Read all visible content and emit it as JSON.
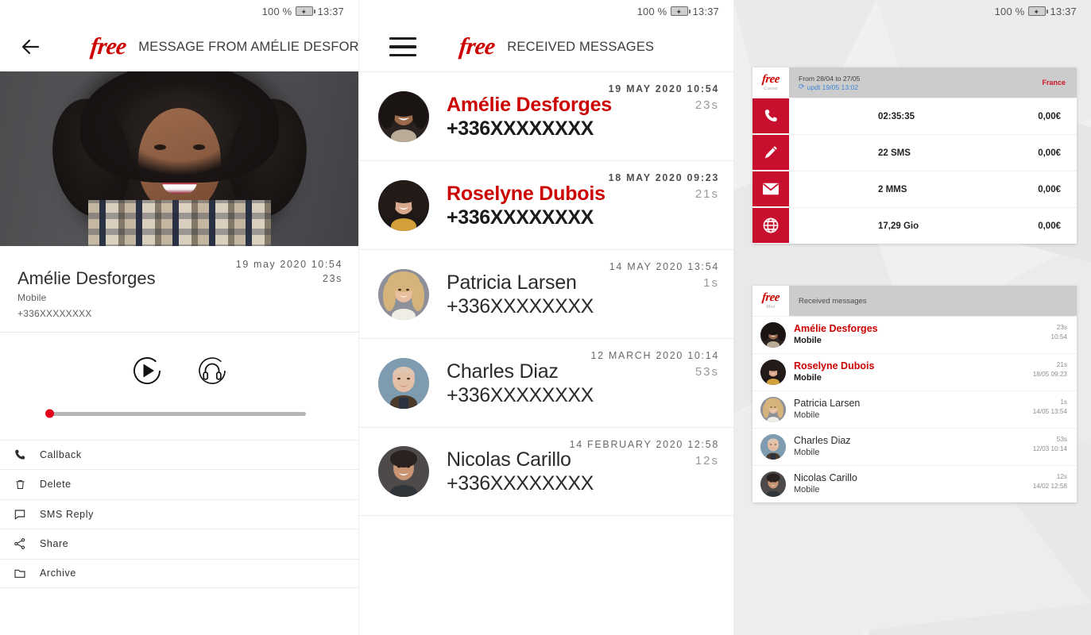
{
  "status_bar": {
    "battery": "100 %",
    "time": "13:37",
    "battery_icon": "battery-charging-icon"
  },
  "brand": {
    "logo_text": "free",
    "logo_color": "#cc0000"
  },
  "panel_detail": {
    "back_icon": "back-arrow-icon",
    "title": "MESSAGE FROM AMÉLIE DESFORGES",
    "hero_alt": "contact-portrait",
    "date": "19 may 2020 10:54",
    "duration": "23s",
    "name": "Amélie Desforges",
    "line_type": "Mobile",
    "phone": "+336XXXXXXXX",
    "player": {
      "play_icon": "play-circle-icon",
      "headphones_icon": "headphones-circle-icon",
      "progress_percent": 0
    },
    "actions": [
      {
        "label": "Callback",
        "icon": "phone-icon"
      },
      {
        "label": "Delete",
        "icon": "trash-icon"
      },
      {
        "label": "SMS Reply",
        "icon": "message-icon"
      },
      {
        "label": "Share",
        "icon": "share-icon"
      },
      {
        "label": "Archive",
        "icon": "folder-icon"
      }
    ]
  },
  "panel_list": {
    "menu_icon": "hamburger-menu-icon",
    "title": "RECEIVED MESSAGES",
    "messages": [
      {
        "name": "Amélie Desforges",
        "phone": "+336XXXXXXXX",
        "date": "19 MAY 2020 10:54",
        "duration": "23s",
        "unread": true
      },
      {
        "name": "Roselyne Dubois",
        "phone": "+336XXXXXXXX",
        "date": "18 MAY 2020 09:23",
        "duration": "21s",
        "unread": true
      },
      {
        "name": "Patricia Larsen",
        "phone": "+336XXXXXXXX",
        "date": "14 MAY 2020 13:54",
        "duration": "1s",
        "unread": false
      },
      {
        "name": "Charles Diaz",
        "phone": "+336XXXXXXXX",
        "date": "12 MARCH 2020 10:14",
        "duration": "53s",
        "unread": false
      },
      {
        "name": "Nicolas Carillo",
        "phone": "+336XXXXXXXX",
        "date": "14 FEBRUARY 2020 12:58",
        "duration": "12s",
        "unread": false
      }
    ]
  },
  "panel_tablet": {
    "consumption_widget": {
      "logo_text": "free",
      "logo_sub": "Conso",
      "period": "From 28/04 to 27/05",
      "updated": "updt 19/05 13:02",
      "refresh_icon": "refresh-icon",
      "zone": "France",
      "rows": [
        {
          "icon": "phone-icon",
          "value": "02:35:35",
          "price": "0,00€"
        },
        {
          "icon": "pencil-sms-icon",
          "value": "22 SMS",
          "price": "0,00€"
        },
        {
          "icon": "envelope-mms-icon",
          "value": "2 MMS",
          "price": "0,00€"
        },
        {
          "icon": "globe-data-icon",
          "value": "17,29 Gio",
          "price": "0,00€"
        }
      ]
    },
    "messages_widget": {
      "logo_text": "free",
      "logo_sub": "Mini",
      "title": "Received messages",
      "rows": [
        {
          "name": "Amélie Desforges",
          "sub": "Mobile",
          "duration": "23s",
          "time": "10:54",
          "unread": true
        },
        {
          "name": "Roselyne Dubois",
          "sub": "Mobile",
          "duration": "21s",
          "time": "18/05 09:23",
          "unread": true
        },
        {
          "name": "Patricia Larsen",
          "sub": "Mobile",
          "duration": "1s",
          "time": "14/05 13:54",
          "unread": false
        },
        {
          "name": "Charles Diaz",
          "sub": "Mobile",
          "duration": "53s",
          "time": "12/03 10:14",
          "unread": false
        },
        {
          "name": "Nicolas Carillo",
          "sub": "Mobile",
          "duration": "12s",
          "time": "14/02 12:58",
          "unread": false
        }
      ]
    }
  }
}
